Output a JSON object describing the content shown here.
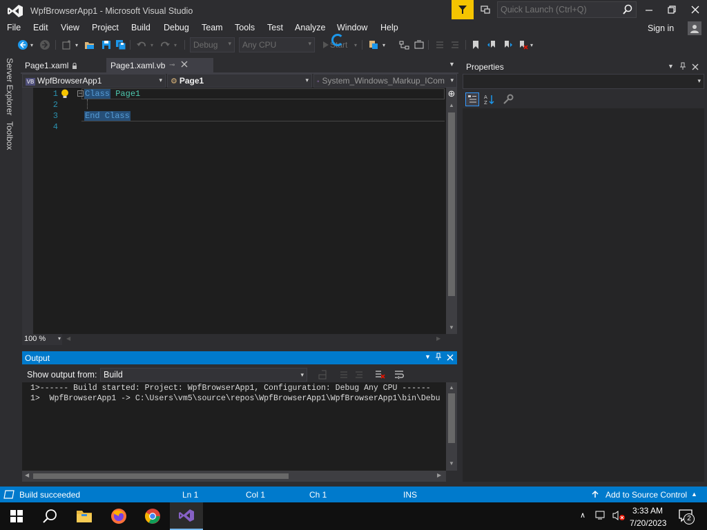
{
  "window": {
    "title": "WpfBrowserApp1 - Microsoft Visual Studio",
    "quick_launch_placeholder": "Quick Launch (Ctrl+Q)"
  },
  "menu": [
    "File",
    "Edit",
    "View",
    "Project",
    "Build",
    "Debug",
    "Team",
    "Tools",
    "Test",
    "Analyze",
    "Window",
    "Help"
  ],
  "account": {
    "sign_in": "Sign in"
  },
  "toolbar": {
    "config": "Debug",
    "platform": "Any CPU",
    "start_label": "Start"
  },
  "side_tabs": [
    "Server Explorer",
    "Toolbox"
  ],
  "doc_tabs": [
    {
      "label": "Page1.xaml",
      "active": false
    },
    {
      "label": "Page1.xaml.vb",
      "active": true
    }
  ],
  "nav": {
    "project": "WpfBrowserApp1",
    "type": "Page1",
    "member": "System_Windows_Markup_ICom"
  },
  "editor": {
    "line_numbers": [
      "1",
      "2",
      "3",
      "4"
    ],
    "kw_class": "Class",
    "class_name": "Page1",
    "kw_end_class": "End Class",
    "zoom": "100 %"
  },
  "output": {
    "title": "Output",
    "show_from_label": "Show output from:",
    "source": "Build",
    "lines": [
      "1>------ Build started: Project: WpfBrowserApp1, Configuration: Debug Any CPU ------",
      "1>  WpfBrowserApp1 -> C:\\Users\\vm5\\source\\repos\\WpfBrowserApp1\\WpfBrowserApp1\\bin\\Debu"
    ]
  },
  "properties": {
    "title": "Properties"
  },
  "status": {
    "message": "Build succeeded",
    "ln": "Ln 1",
    "col": "Col 1",
    "ch": "Ch 1",
    "mode": "INS",
    "source_control": "Add to Source Control"
  },
  "taskbar": {
    "time": "3:33 AM",
    "date": "7/20/2023",
    "notifications": "2"
  },
  "colors": {
    "accent": "#007acc",
    "notification": "#f5c400",
    "editor_bg": "#1e1e1e",
    "keyword": "#569cd6",
    "type": "#4ec9b0"
  }
}
